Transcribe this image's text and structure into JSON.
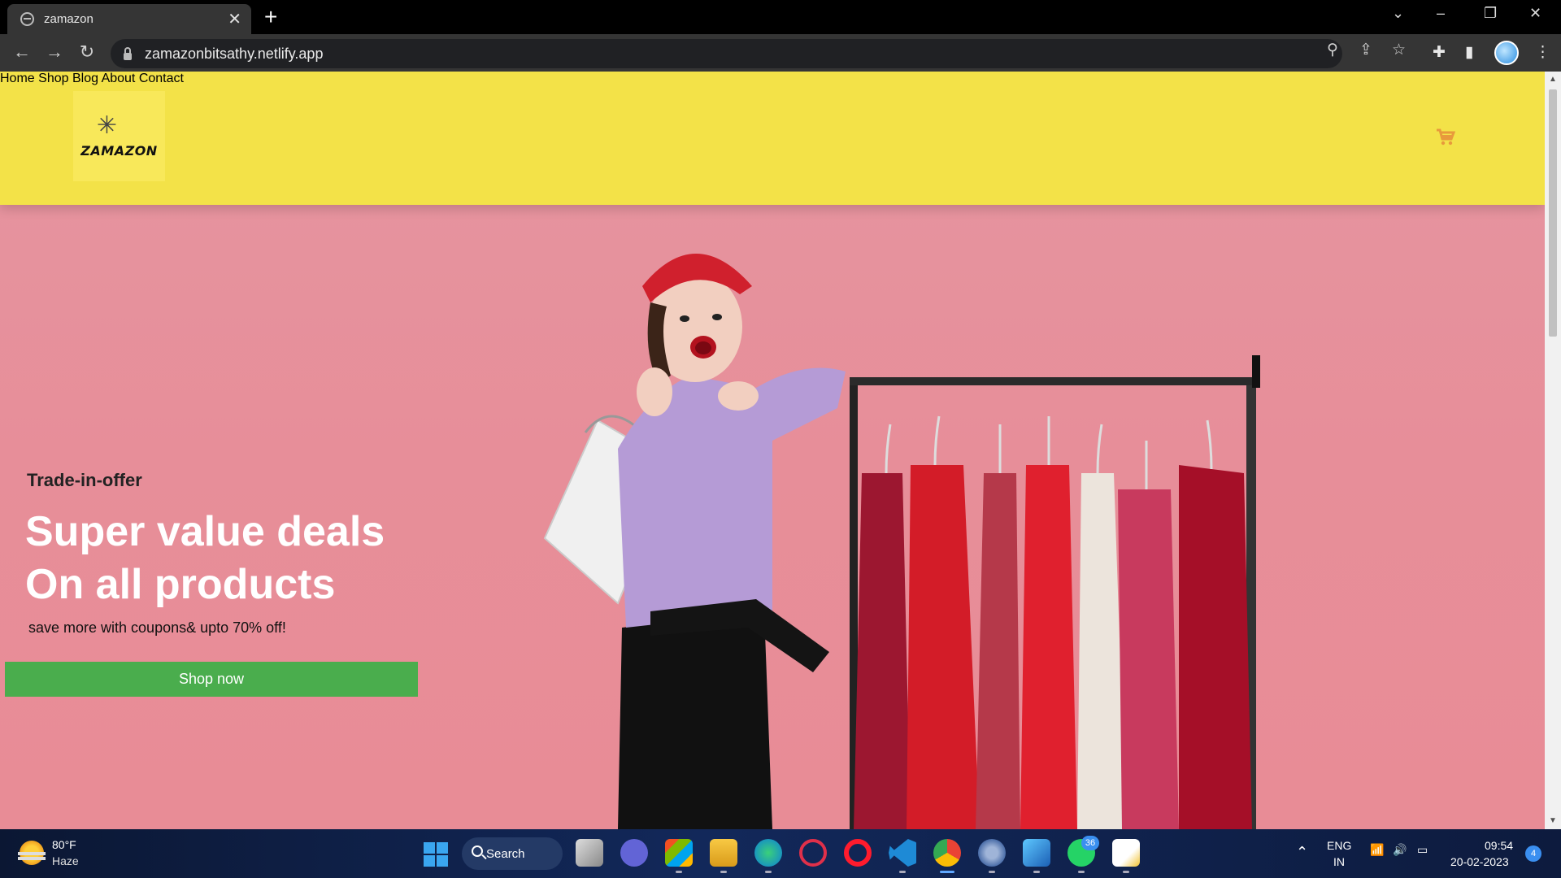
{
  "browser": {
    "tab_title": "zamazon",
    "url": "zamazonbitsathy.netlify.app"
  },
  "site": {
    "logo_text": "ZAMAZON",
    "nav": [
      {
        "label": "Home",
        "active": true
      },
      {
        "label": "Shop",
        "active": false
      },
      {
        "label": "Blog",
        "active": false
      },
      {
        "label": "About",
        "active": false
      },
      {
        "label": "Contact",
        "active": false
      }
    ],
    "cart_icon": "cart-icon",
    "accent_color": "#e89a3c",
    "header_bg": "#f3e248"
  },
  "hero": {
    "kicker": "Trade-in-offer",
    "headline_line1": "Super value deals",
    "headline_line2": "On all products",
    "subline": "save more with coupons& upto 70% off!",
    "cta": "Shop now",
    "cta_color": "#4aad4d",
    "bg_color": "#e78e99"
  },
  "taskbar": {
    "weather_temp": "80°F",
    "weather_cond": "Haze",
    "search_label": "Search",
    "whatsapp_badge": "36",
    "lang_line1": "ENG",
    "lang_line2": "IN",
    "time": "09:54",
    "date": "20-02-2023",
    "notifications": "4"
  }
}
